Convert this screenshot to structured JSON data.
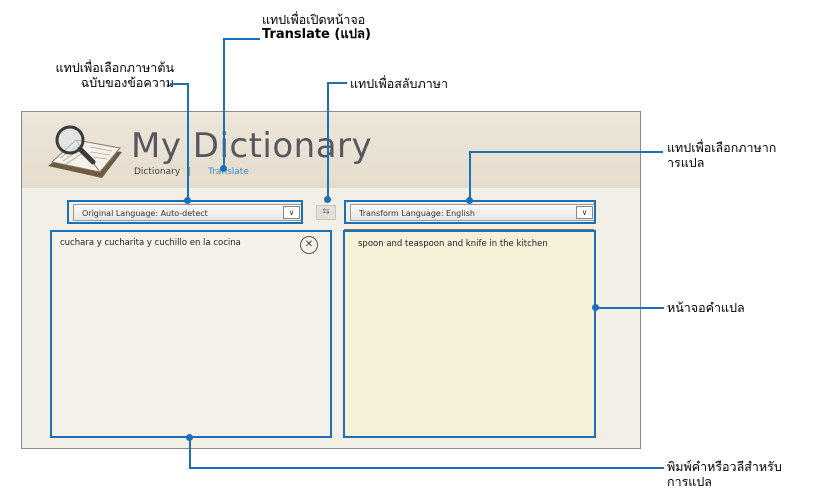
{
  "callouts": {
    "translate_line1": "แทปเพื่อเปิดหน้าจอ",
    "translate_line2": "Translate (แปล)",
    "source_line1": "แทปเพื่อเลือกภาษาต้น",
    "source_line2": "ฉบับของข้อความ",
    "swap": "แทปเพื่อสลับภาษา",
    "target_line1": "แทปเพื่อเลือกภาษาก",
    "target_line2": "ารแปล",
    "result": "หน้าจอคำแปล",
    "input_line1": "พิมพ์คำหรือวลีสำหรับ",
    "input_line2": "การแปล"
  },
  "app": {
    "title": "My Dictionary",
    "nav_dictionary": "Dictionary",
    "nav_separator": "|",
    "nav_translate": "Translate"
  },
  "source": {
    "dropdown_label": "Original Language: Auto-detect",
    "text": "cuchara y cucharita y cuchillo en la cocina"
  },
  "target": {
    "dropdown_label": "Transform Language: English",
    "text": "spoon and teaspoon and knife in the kitchen"
  },
  "icons": {
    "chevron": "∨",
    "clear": "✕",
    "swap": "⇆"
  },
  "colors": {
    "callout_blue": "#1d6fb8",
    "translate_active": "#3b8fd0"
  }
}
